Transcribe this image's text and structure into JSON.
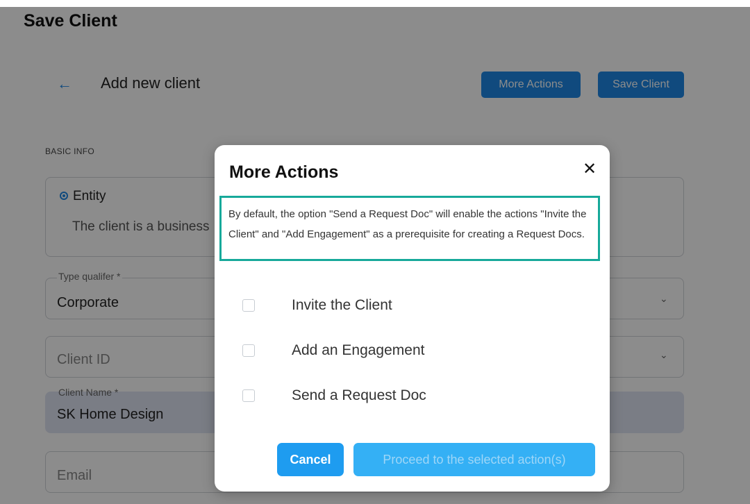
{
  "page": {
    "title": "Save Client",
    "subtitle": "Add new client",
    "more_actions_label": "More Actions",
    "save_client_label": "Save Client",
    "section_label": "BASIC INFO",
    "entity_label": "Entity",
    "entity_desc": "The client is a business",
    "type_qualifier_label": "Type qualifer *",
    "type_qualifier_value": "Corporate",
    "client_id_placeholder": "Client ID",
    "client_name_label": "Client Name *",
    "client_name_value": "SK Home Design",
    "email_placeholder": "Email"
  },
  "modal": {
    "title": "More Actions",
    "note": "By default, the option \"Send a Request Doc\" will enable the actions \"Invite the Client\" and \"Add Engagement\" as a prerequisite for creating a Request Docs.",
    "options": [
      {
        "label": "Invite the Client",
        "checked": false
      },
      {
        "label": "Add an Engagement",
        "checked": false
      },
      {
        "label": "Send a Request Doc",
        "checked": false
      }
    ],
    "cancel_label": "Cancel",
    "proceed_label": "Proceed to the selected action(s)"
  },
  "icons": {
    "back": "arrow-left-icon",
    "close": "close-icon",
    "dropdown": "chevron-down-icon"
  },
  "colors": {
    "primary": "#1e88e5",
    "note_border": "#17a99a",
    "proceed_bg": "#34b0f5"
  }
}
